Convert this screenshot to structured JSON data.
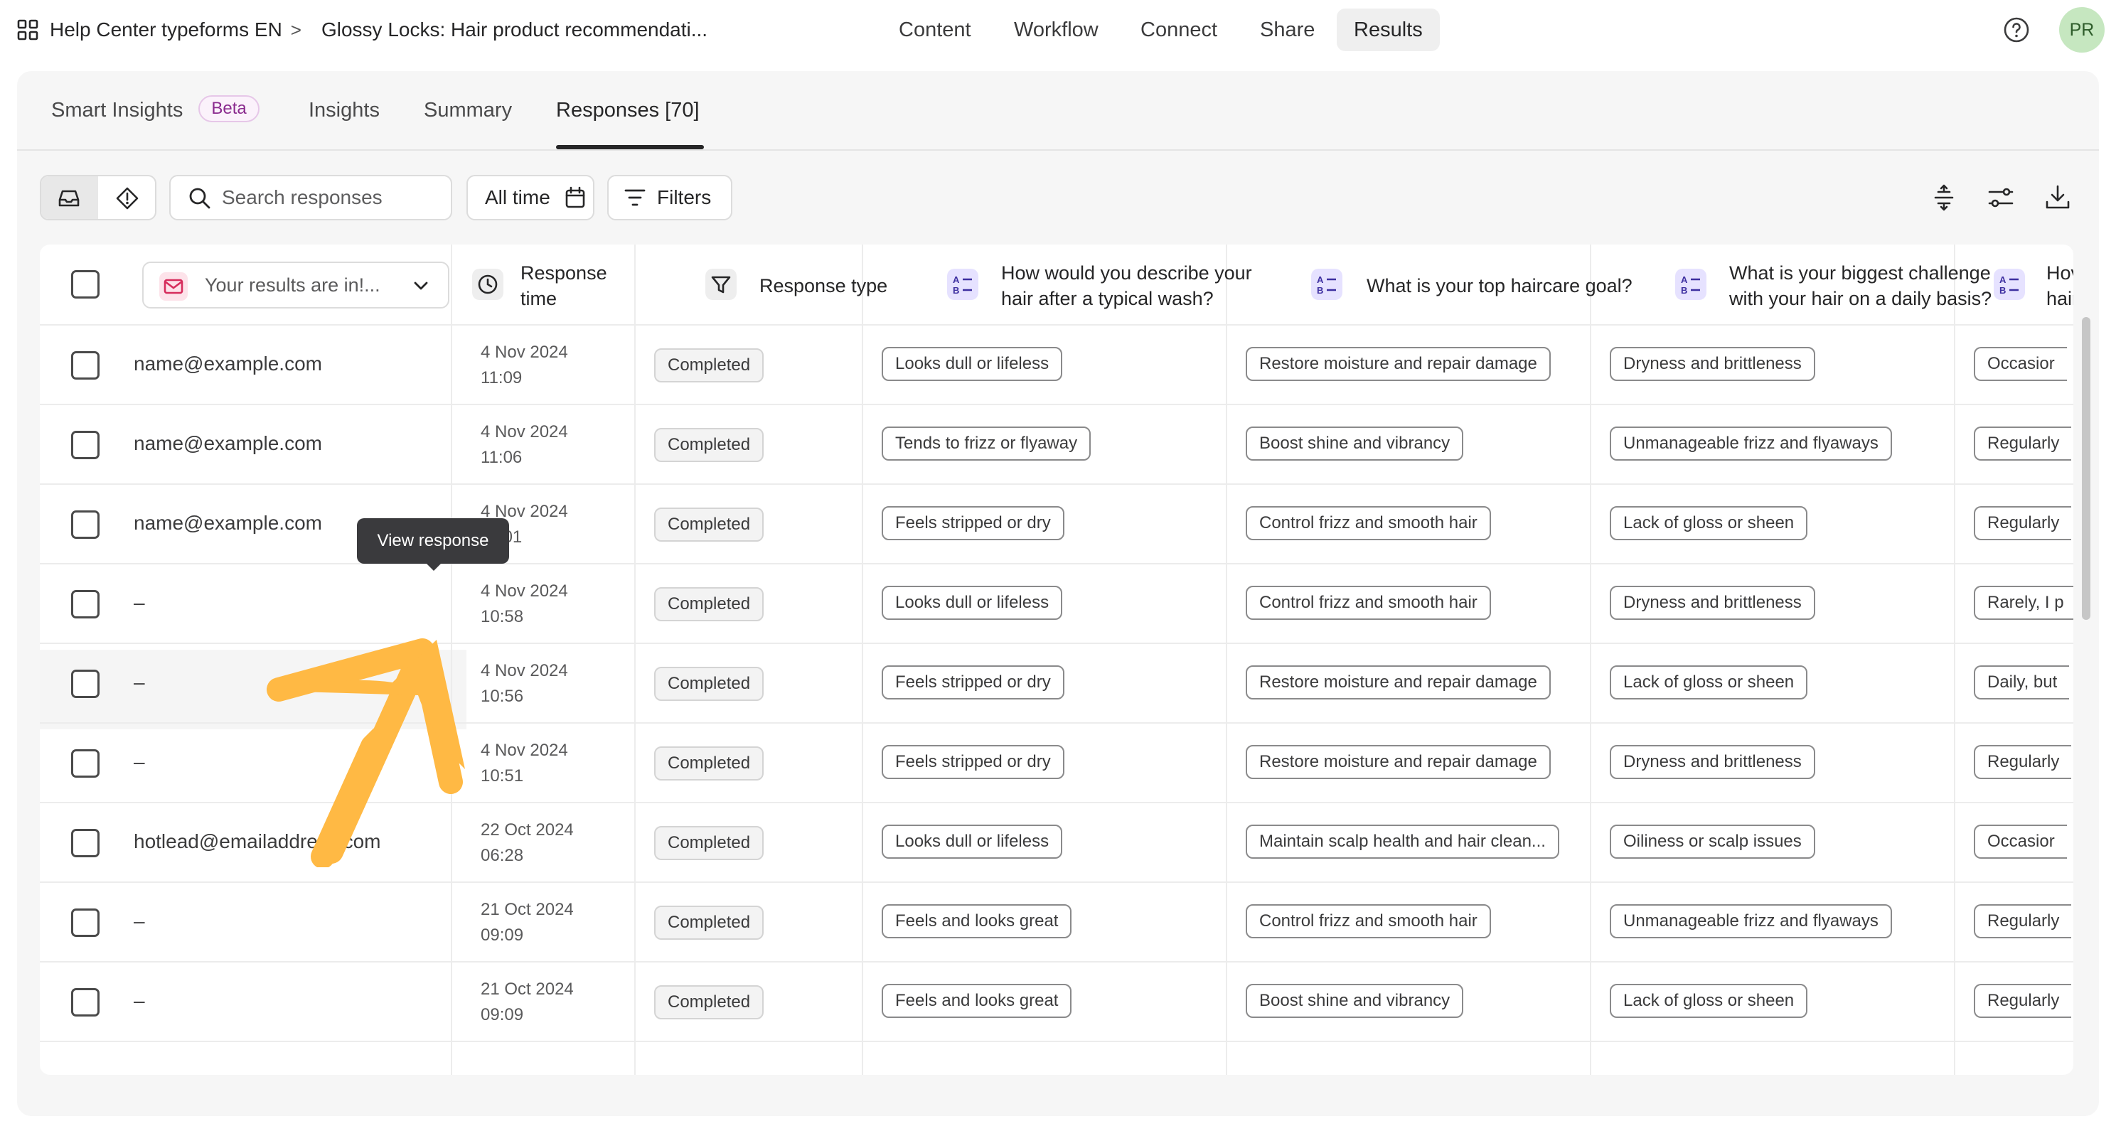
{
  "breadcrumb": {
    "workspace": "Help Center typeforms EN",
    "separator": ">",
    "form": "Glossy Locks: Hair product recommendati..."
  },
  "nav": [
    {
      "label": "Content"
    },
    {
      "label": "Workflow"
    },
    {
      "label": "Connect"
    },
    {
      "label": "Share"
    },
    {
      "label": "Results",
      "active": true
    }
  ],
  "user": {
    "initials": "PR"
  },
  "tabs": [
    {
      "label": "Smart Insights",
      "badge": "Beta"
    },
    {
      "label": "Insights"
    },
    {
      "label": "Summary"
    },
    {
      "label": "Responses [70]",
      "active": true
    }
  ],
  "toolbar": {
    "search_placeholder": "Search responses",
    "time_filter": "All time",
    "filters_label": "Filters"
  },
  "tooltip": "View response",
  "table": {
    "email_column_label": "Your results are in!...",
    "columns": [
      "Response time",
      "Response type",
      "How would you describe your hair after a typical wash?",
      "What is your top haircare goal?",
      "What is your biggest challenge with your hair on a daily basis?",
      "How often ... hair ..."
    ],
    "col_lines": {
      "time": [
        "Response",
        "time"
      ],
      "q1": [
        "How would you describe your",
        "hair after a typical wash?"
      ],
      "q2": [
        "What is your top haircare goal?"
      ],
      "q3": [
        "What is your biggest challenge",
        "with your hair on a daily basis?"
      ],
      "q4": [
        "Hov",
        "hair"
      ]
    },
    "rows": [
      {
        "email": "name@example.com",
        "date": "4 Nov 2024",
        "time": "11:09",
        "type": "Completed",
        "q1": "Looks dull or lifeless",
        "q2": "Restore moisture and repair damage",
        "q3": "Dryness and brittleness",
        "q4": "Occasior"
      },
      {
        "email": "name@example.com",
        "date": "4 Nov 2024",
        "time": "11:06",
        "type": "Completed",
        "q1": "Tends to frizz or flyaway",
        "q2": "Boost shine and vibrancy",
        "q3": "Unmanageable frizz and flyaways",
        "q4": "Regularly"
      },
      {
        "email": "name@example.com",
        "date": "4 Nov 2024",
        "time": "11:01",
        "type": "Completed",
        "q1": "Feels stripped or dry",
        "q2": "Control frizz and smooth hair",
        "q3": "Lack of gloss or sheen",
        "q4": "Regularly"
      },
      {
        "email": "–",
        "date": "4 Nov 2024",
        "time": "10:58",
        "type": "Completed",
        "q1": "Looks dull or lifeless",
        "q2": "Control frizz and smooth hair",
        "q3": "Dryness and brittleness",
        "q4": "Rarely, I p"
      },
      {
        "email": "–",
        "date": "4 Nov 2024",
        "time": "10:56",
        "type": "Completed",
        "q1": "Feels stripped or dry",
        "q2": "Restore moisture and repair damage",
        "q3": "Lack of gloss or sheen",
        "q4": "Daily, but"
      },
      {
        "email": "–",
        "date": "4 Nov 2024",
        "time": "10:51",
        "type": "Completed",
        "q1": "Feels stripped or dry",
        "q2": "Restore moisture and repair damage",
        "q3": "Dryness and brittleness",
        "q4": "Regularly"
      },
      {
        "email": "hotlead@emailaddress.com",
        "date": "22 Oct 2024",
        "time": "06:28",
        "type": "Completed",
        "q1": "Looks dull or lifeless",
        "q2": "Maintain scalp health and hair clean...",
        "q3": "Oiliness or scalp issues",
        "q4": "Occasior"
      },
      {
        "email": "–",
        "date": "21 Oct 2024",
        "time": "09:09",
        "type": "Completed",
        "q1": "Feels and looks great",
        "q2": "Control frizz and smooth hair",
        "q3": "Unmanageable frizz and flyaways",
        "q4": "Regularly"
      },
      {
        "email": "–",
        "date": "21 Oct 2024",
        "time": "09:09",
        "type": "Completed",
        "q1": "Feels and looks great",
        "q2": "Boost shine and vibrancy",
        "q3": "Lack of gloss or sheen",
        "q4": "Regularly"
      }
    ]
  },
  "colors": {
    "accent_arrow": "#ffb944",
    "tooltip_bg": "#3a3a3d",
    "beta_text": "#8a2a8e",
    "question_icon_bg": "#e6e2ff"
  }
}
